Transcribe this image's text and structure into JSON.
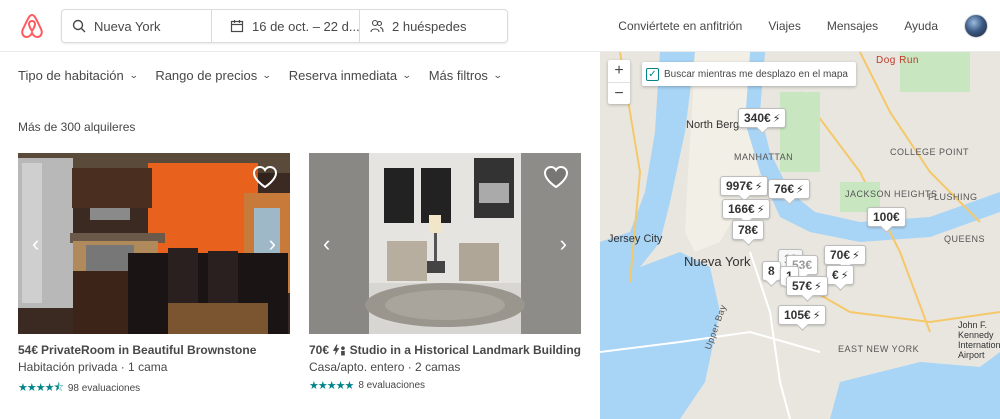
{
  "header": {
    "search": {
      "location": "Nueva York",
      "dates": "16 de oct. – 22 d...",
      "guests": "2 huéspedes"
    },
    "nav": [
      "Conviértete en anfitrión",
      "Viajes",
      "Mensajes",
      "Ayuda"
    ]
  },
  "filters": [
    "Tipo de habitación",
    "Rango de precios",
    "Reserva inmediata",
    "Más filtros"
  ],
  "results_count": "Más de 300 alquileres",
  "listings": [
    {
      "price": "54€",
      "name": "PrivateRoom in Beautiful Brownstone",
      "subtitle": "Habitación privada · 1 cama",
      "reviews": "98 evaluaciones",
      "stars": 4.5
    },
    {
      "price": "70€",
      "name": "Studio in a Historical Landmark Building",
      "subtitle": "Casa/apto. entero · 2 camas",
      "reviews": "8 evaluaciones",
      "stars": 5
    }
  ],
  "map": {
    "zoom_in": "+",
    "zoom_out": "−",
    "search_as_move": "Buscar mientras me desplazo en el mapa",
    "labels": {
      "north_bergen": "North Bergen",
      "manhattan": "MANHATTAN",
      "jersey_city": "Jersey City",
      "nueva_york": "Nueva York",
      "jackson_heights": "JACKSON HEIGHTS",
      "queens": "QUEENS",
      "college_point": "COLLEGE POINT",
      "flushing": "FLUSHING",
      "dog_run": "Dog Run",
      "east_new_york": "EAST NEW YORK",
      "jfk": "John F. Kennedy International Airport",
      "upper_bay": "Upper Bay"
    },
    "pins": [
      {
        "label": "340€",
        "bolt": true
      },
      {
        "label": "997€",
        "bolt": true
      },
      {
        "label": "76€",
        "bolt": true
      },
      {
        "label": "166€",
        "bolt": true
      },
      {
        "label": "78€",
        "bolt": false
      },
      {
        "label": "100€",
        "bolt": false
      },
      {
        "label": "70€",
        "bolt": true
      },
      {
        "label": "57€",
        "bolt": true
      },
      {
        "label": "105€",
        "bolt": true
      }
    ]
  },
  "colors": {
    "brand": "#FF5A5F",
    "teal": "#008489",
    "water": "#a8d4f5",
    "land": "#e8e6df"
  }
}
